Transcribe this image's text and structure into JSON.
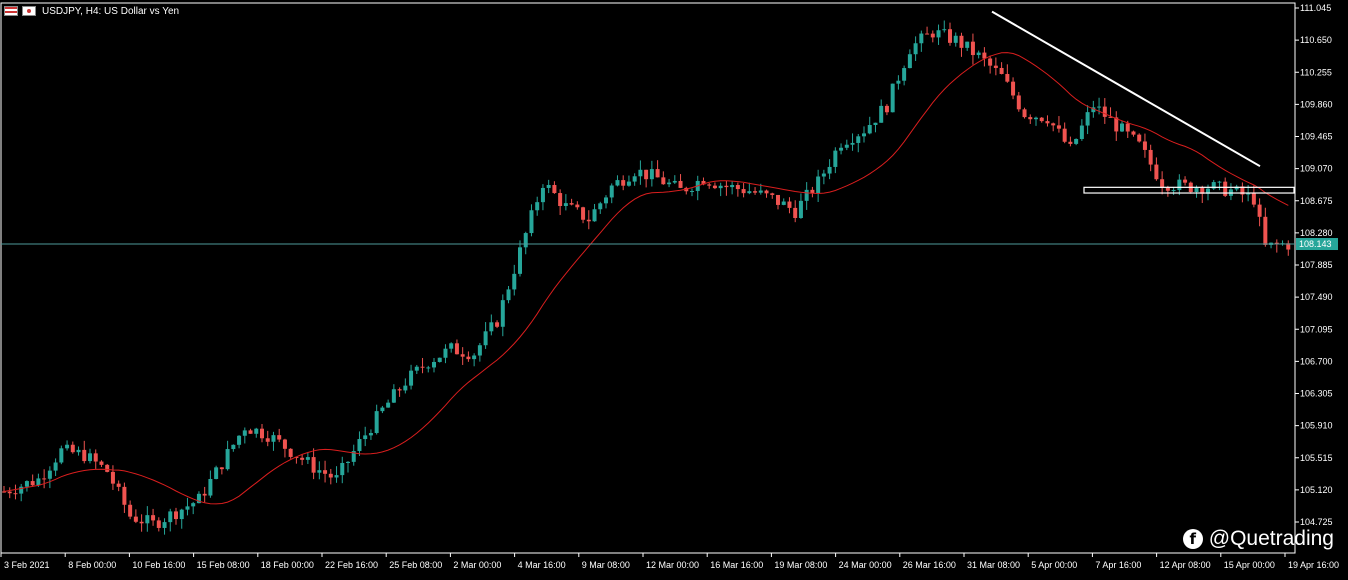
{
  "header": {
    "symbol_text": "USDJPY, H4:  US Dollar vs Yen",
    "icons": [
      "us-flag-icon",
      "jp-flag-icon"
    ]
  },
  "watermark": {
    "text": "@Quetrading",
    "icon": "facebook-icon"
  },
  "colors": {
    "background": "#000000",
    "bull": "#26a69a",
    "bear": "#ef5350",
    "ma": "#d91e1e",
    "price_line": "#4e9a9a",
    "price_tag": "#26a69a",
    "axis_text": "#ffffff",
    "trendline": "#ffffff"
  },
  "chart_data": {
    "type": "candlestick",
    "title": "USDJPY, H4:  US Dollar vs Yen",
    "ylim": [
      104.6,
      111.15
    ],
    "y_ticks": [
      "111.045",
      "110.650",
      "110.255",
      "109.860",
      "109.465",
      "109.070",
      "108.675",
      "108.280",
      "107.885",
      "107.490",
      "107.095",
      "106.700",
      "106.305",
      "105.910",
      "105.515",
      "105.120",
      "104.725"
    ],
    "current_price": "108.143",
    "x_ticks": [
      "3 Feb 2021",
      "8 Feb 00:00",
      "10 Feb 16:00",
      "15 Feb 08:00",
      "18 Feb 00:00",
      "22 Feb 16:00",
      "25 Feb 08:00",
      "2 Mar 00:00",
      "4 Mar 16:00",
      "9 Mar 08:00",
      "12 Mar 00:00",
      "16 Mar 16:00",
      "19 Mar 08:00",
      "24 Mar 00:00",
      "26 Mar 16:00",
      "31 Mar 08:00",
      "5 Apr 00:00",
      "7 Apr 16:00",
      "12 Apr 08:00",
      "15 Apr 00:00",
      "19 Apr 16:00"
    ],
    "close_path": [
      [
        0,
        105.1
      ],
      [
        6,
        105.25
      ],
      [
        10,
        105.6
      ],
      [
        14,
        105.55
      ],
      [
        18,
        105.35
      ],
      [
        22,
        104.8
      ],
      [
        26,
        104.7
      ],
      [
        30,
        104.85
      ],
      [
        34,
        105.0
      ],
      [
        38,
        105.45
      ],
      [
        42,
        105.9
      ],
      [
        46,
        105.8
      ],
      [
        50,
        105.6
      ],
      [
        54,
        105.4
      ],
      [
        58,
        105.25
      ],
      [
        62,
        105.7
      ],
      [
        66,
        106.1
      ],
      [
        70,
        106.45
      ],
      [
        74,
        106.7
      ],
      [
        78,
        106.85
      ],
      [
        82,
        106.8
      ],
      [
        86,
        107.2
      ],
      [
        90,
        108.05
      ],
      [
        94,
        108.9
      ],
      [
        98,
        108.6
      ],
      [
        102,
        108.45
      ],
      [
        106,
        108.85
      ],
      [
        110,
        109.05
      ],
      [
        114,
        108.95
      ],
      [
        118,
        108.8
      ],
      [
        122,
        108.95
      ],
      [
        126,
        108.85
      ],
      [
        130,
        108.8
      ],
      [
        134,
        108.7
      ],
      [
        138,
        108.55
      ],
      [
        142,
        108.9
      ],
      [
        146,
        109.4
      ],
      [
        150,
        109.55
      ],
      [
        154,
        109.85
      ],
      [
        158,
        110.55
      ],
      [
        162,
        110.75
      ],
      [
        166,
        110.65
      ],
      [
        170,
        110.45
      ],
      [
        174,
        110.2
      ],
      [
        178,
        109.75
      ],
      [
        182,
        109.7
      ],
      [
        186,
        109.3
      ],
      [
        190,
        109.85
      ],
      [
        194,
        109.6
      ],
      [
        198,
        109.35
      ],
      [
        202,
        108.9
      ],
      [
        206,
        108.85
      ],
      [
        210,
        108.85
      ],
      [
        214,
        108.8
      ],
      [
        218,
        108.7
      ],
      [
        220,
        108.1
      ],
      [
        223,
        108.14
      ]
    ],
    "ma_period": 20,
    "trendline": {
      "from": [
        "31 Mar",
        111.0
      ],
      "to": [
        "15 Apr",
        109.1
      ]
    },
    "support_zone": [
      108.77,
      108.84
    ]
  }
}
